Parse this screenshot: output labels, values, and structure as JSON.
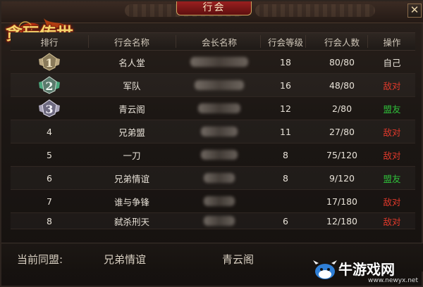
{
  "window": {
    "tab_title": "行会",
    "close_label": "✕"
  },
  "logo": {
    "text": "贪玩传世"
  },
  "table": {
    "columns": [
      "排行",
      "行会名称",
      "会长名称",
      "行会等级",
      "行会人数",
      "操作"
    ],
    "rows": [
      {
        "rank": "1",
        "name": "名人堂",
        "level": "18",
        "members": "80/80",
        "op": "自己",
        "op_type": "self"
      },
      {
        "rank": "2",
        "name": "军队",
        "level": "16",
        "members": "48/80",
        "op": "敌对",
        "op_type": "enemy"
      },
      {
        "rank": "3",
        "name": "青云阁",
        "level": "12",
        "members": "2/80",
        "op": "盟友",
        "op_type": "ally"
      },
      {
        "rank": "4",
        "name": "兄弟盟",
        "level": "11",
        "members": "27/80",
        "op": "敌对",
        "op_type": "enemy"
      },
      {
        "rank": "5",
        "name": "一刀",
        "level": "8",
        "members": "75/120",
        "op": "敌对",
        "op_type": "enemy"
      },
      {
        "rank": "6",
        "name": "兄弟情谊",
        "level": "8",
        "members": "9/120",
        "op": "盟友",
        "op_type": "ally"
      },
      {
        "rank": "7",
        "name": "谁与争锋",
        "level": "",
        "members": "17/180",
        "op": "敌对",
        "op_type": "enemy"
      },
      {
        "rank": "8",
        "name": "弑杀刑天",
        "level": "6",
        "members": "12/180",
        "op": "敌对",
        "op_type": "enemy"
      }
    ]
  },
  "alliance": {
    "label": "当前同盟:",
    "members": [
      "兄弟情谊",
      "青云阁"
    ]
  },
  "watermark": {
    "text": "牛游戏网",
    "url": "www.newyx.net"
  },
  "colors": {
    "enemy": "#e0392b",
    "ally": "#2fbf3a",
    "tab_red": "#9a1f1f",
    "gold": "#f5d36b"
  }
}
